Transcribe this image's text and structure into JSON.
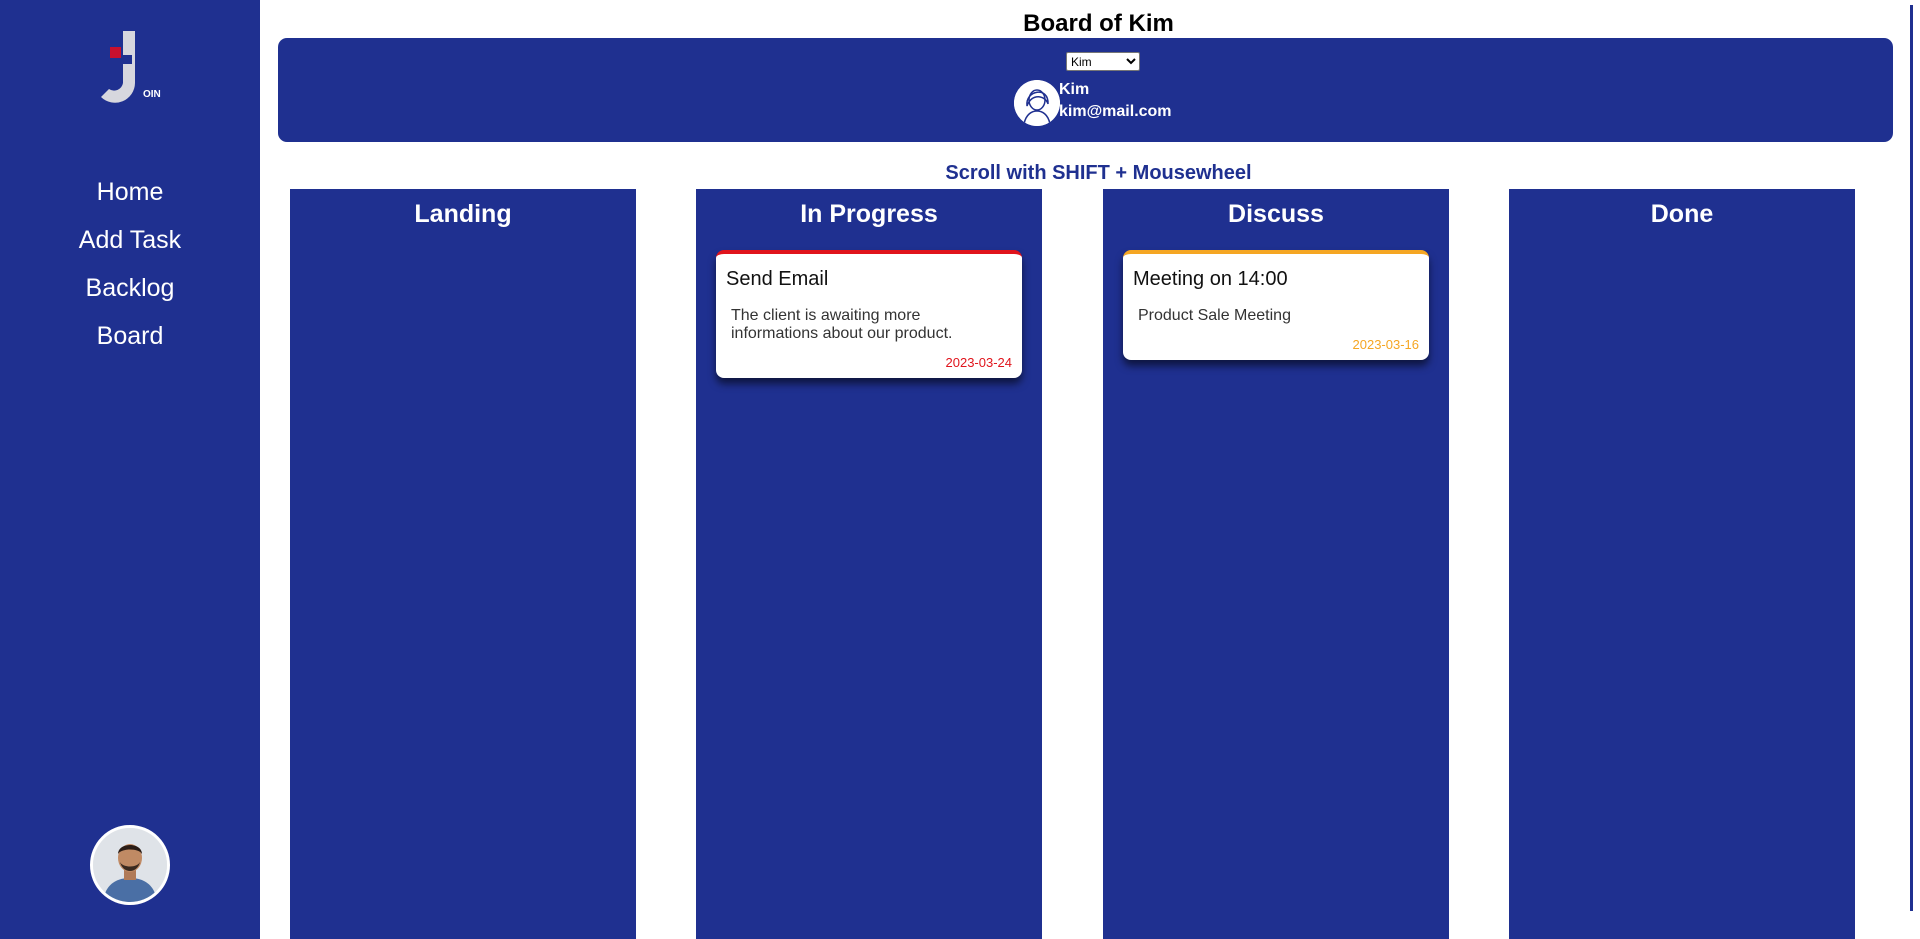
{
  "sidebar": {
    "logo_text": "OIN",
    "nav": [
      "Home",
      "Add Task",
      "Backlog",
      "Board"
    ]
  },
  "board": {
    "title": "Board of Kim",
    "selected_user": "Kim",
    "user_options": [
      "Kim"
    ],
    "user_name": "Kim",
    "user_email": "kim@mail.com",
    "scroll_hint": "Scroll with SHIFT + Mousewheel"
  },
  "columns": [
    {
      "title": "Landing"
    },
    {
      "title": "In Progress"
    },
    {
      "title": "Discuss"
    },
    {
      "title": "Done"
    }
  ],
  "cards": [
    {
      "title": "Send Email",
      "description": "The client is awaiting more informations about our product.",
      "date": "2023-03-24",
      "accent_color": "#e0141c"
    },
    {
      "title": "Meeting on 14:00",
      "description": "Product Sale Meeting",
      "date": "2023-03-16",
      "accent_color": "#f5a623"
    }
  ],
  "colors": {
    "brand": "#1f3090",
    "logo_accent": "#c8102e"
  }
}
